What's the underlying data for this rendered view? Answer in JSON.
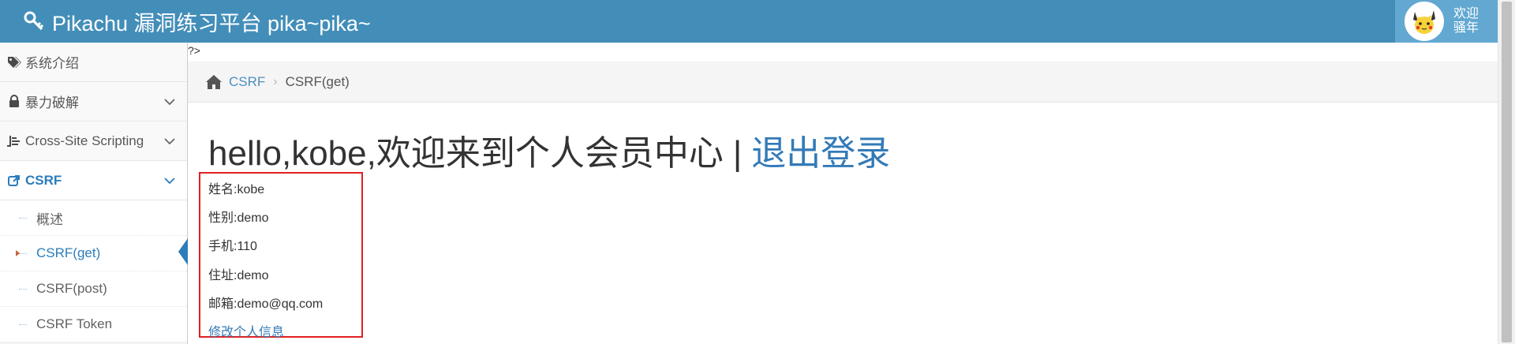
{
  "navbar": {
    "brand": "Pikachu 漏洞练习平台 pika~pika~",
    "user_greeting_line1": "欢迎",
    "user_greeting_line2": "骚年"
  },
  "sidebar": {
    "items": [
      {
        "label": "系统介绍",
        "icon": "tags-icon",
        "expandable": false
      },
      {
        "label": "暴力破解",
        "icon": "lock-icon",
        "expandable": true
      },
      {
        "label": "Cross-Site Scripting",
        "icon": "list-icon",
        "expandable": true
      },
      {
        "label": "CSRF",
        "icon": "external-link-icon",
        "expandable": true,
        "active": true
      }
    ],
    "csrf_subitems": [
      {
        "label": "概述"
      },
      {
        "label": "CSRF(get)",
        "active": true
      },
      {
        "label": "CSRF(post)"
      },
      {
        "label": "CSRF Token"
      }
    ]
  },
  "main": {
    "php_fragment": "?>",
    "breadcrumb": {
      "link": "CSRF",
      "separator": "›",
      "current": "CSRF(get)"
    },
    "hello_text": "hello,kobe,欢迎来到个人会员中心",
    "hello_separator": "|",
    "logout_link": "退出登录",
    "info": {
      "name": "姓名:kobe",
      "gender": "性别:demo",
      "phone": "手机:110",
      "address": "住址:demo",
      "email": "邮箱:demo@qq.com",
      "edit_link": "修改个人信息"
    }
  },
  "colors": {
    "navbar": "#438eb9",
    "accent": "#2b7dbc",
    "link": "#337ab7",
    "highlight_box": "#e02020"
  }
}
